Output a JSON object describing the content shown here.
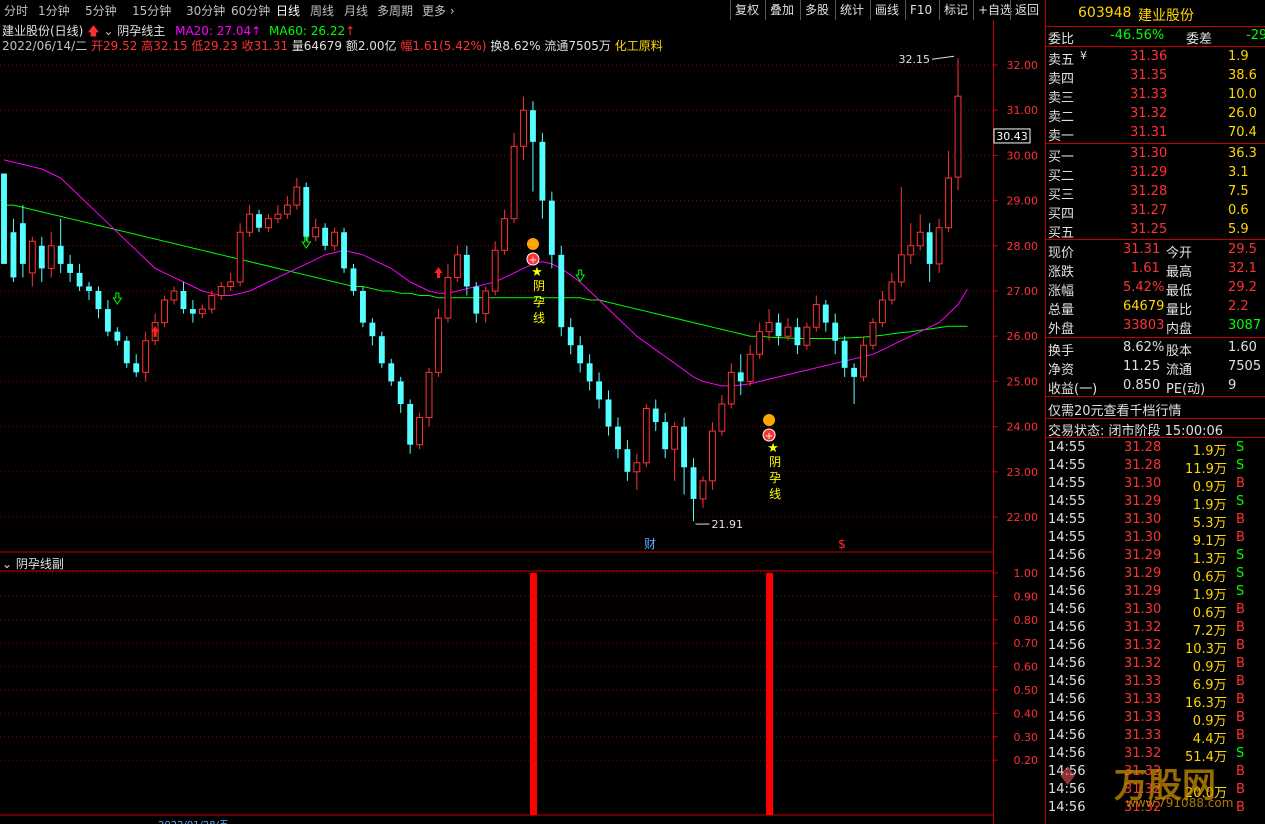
{
  "toolbar": {
    "periods": [
      "分时",
      "1分钟",
      "5分钟",
      "15分钟",
      "30分钟",
      "60分钟",
      "日线",
      "周线",
      "月线",
      "多周期",
      "更多"
    ],
    "active_period": "日线",
    "buttons": [
      "复权",
      "叠加",
      "多股",
      "统计",
      "画线",
      "F10",
      "标记",
      "+自选",
      "返回"
    ]
  },
  "chart_header": {
    "title": "建业股份(日线)",
    "indicator": "阴孕线主",
    "ma20": "MA20: 27.04",
    "ma60": "MA60: 26.22",
    "date": "2022/06/14/二",
    "open": "开29.52",
    "high": "高32.15",
    "low": "低29.23",
    "close": "收31.31",
    "volume": "量64679",
    "amount": "额2.00亿",
    "change": "幅1.61(5.42%)",
    "turnover": "换8.62%",
    "float": "流通7505万",
    "sector": "化工原料"
  },
  "sub_header": "阴孕线副",
  "annotations": {
    "peak": "32.15",
    "trough": "21.91",
    "signal_text": "阴孕线",
    "badge_cai": "财",
    "badge_dollar": "$",
    "current_price": "30.43"
  },
  "colors": {
    "up": "#ff3232",
    "down": "#54ffff",
    "ma20": "#ff00ff",
    "ma60": "#00ff00",
    "grid": "#8b0000",
    "signal": "#ff0000"
  },
  "main_axis": [
    "32.00",
    "31.00",
    "30.00",
    "29.00",
    "28.00",
    "27.00",
    "26.00",
    "25.00",
    "24.00",
    "23.00",
    "22.00"
  ],
  "sub_axis": [
    "1.00",
    "0.90",
    "0.80",
    "0.70",
    "0.60",
    "0.50",
    "0.40",
    "0.30",
    "0.20"
  ],
  "bottom_date": "2022/01/28/五",
  "panel": {
    "code": "603948",
    "name": "建业股份",
    "webi_label": "委比",
    "webi_value": "-46.56%",
    "weicha_label": "委差",
    "weicha_value": "-29",
    "asks": [
      {
        "label": "卖五",
        "price": "31.36",
        "vol": "1.9"
      },
      {
        "label": "卖四",
        "price": "31.35",
        "vol": "38.6"
      },
      {
        "label": "卖三",
        "price": "31.33",
        "vol": "10.0"
      },
      {
        "label": "卖二",
        "price": "31.32",
        "vol": "26.0"
      },
      {
        "label": "卖一",
        "price": "31.31",
        "vol": "70.4"
      }
    ],
    "bids": [
      {
        "label": "买一",
        "price": "31.30",
        "vol": "36.3"
      },
      {
        "label": "买二",
        "price": "31.29",
        "vol": "3.1"
      },
      {
        "label": "买三",
        "price": "31.28",
        "vol": "7.5"
      },
      {
        "label": "买四",
        "price": "31.27",
        "vol": "0.6"
      },
      {
        "label": "买五",
        "price": "31.25",
        "vol": "5.9"
      }
    ],
    "stats": [
      {
        "l1": "现价",
        "v1": "31.31",
        "l2": "今开",
        "v2": "29.5"
      },
      {
        "l1": "涨跌",
        "v1": "1.61",
        "l2": "最高",
        "v2": "32.1"
      },
      {
        "l1": "涨幅",
        "v1": "5.42%",
        "l2": "最低",
        "v2": "29.2"
      },
      {
        "l1": "总量",
        "v1": "64679",
        "l2": "量比",
        "v2": "2.2"
      },
      {
        "l1": "外盘",
        "v1": "33803",
        "l2": "内盘",
        "v2": "3087"
      }
    ],
    "stats2": [
      {
        "l1": "换手",
        "v1": "8.62%",
        "l2": "股本",
        "v2": "1.60"
      },
      {
        "l1": "净资",
        "v1": "11.25",
        "l2": "流通",
        "v2": "7505"
      },
      {
        "l1": "收益(一)",
        "v1": "0.850",
        "l2": "PE(动)",
        "v2": "9"
      }
    ],
    "promo": "仅需20元查看千档行情",
    "status": "交易状态: 闭市阶段 15:00:06",
    "trades": [
      {
        "time": "14:55",
        "price": "31.28",
        "vol": "1.9万",
        "side": "S"
      },
      {
        "time": "14:55",
        "price": "31.28",
        "vol": "11.9万",
        "side": "S"
      },
      {
        "time": "14:55",
        "price": "31.30",
        "vol": "0.9万",
        "side": "B"
      },
      {
        "time": "14:55",
        "price": "31.29",
        "vol": "1.9万",
        "side": "S"
      },
      {
        "time": "14:55",
        "price": "31.30",
        "vol": "5.3万",
        "side": "B"
      },
      {
        "time": "14:55",
        "price": "31.30",
        "vol": "9.1万",
        "side": "B"
      },
      {
        "time": "14:56",
        "price": "31.29",
        "vol": "1.3万",
        "side": "S"
      },
      {
        "time": "14:56",
        "price": "31.29",
        "vol": "0.6万",
        "side": "S"
      },
      {
        "time": "14:56",
        "price": "31.29",
        "vol": "1.9万",
        "side": "S"
      },
      {
        "time": "14:56",
        "price": "31.30",
        "vol": "0.6万",
        "side": "B"
      },
      {
        "time": "14:56",
        "price": "31.32",
        "vol": "7.2万",
        "side": "B"
      },
      {
        "time": "14:56",
        "price": "31.32",
        "vol": "10.3万",
        "side": "B"
      },
      {
        "time": "14:56",
        "price": "31.32",
        "vol": "0.9万",
        "side": "B"
      },
      {
        "time": "14:56",
        "price": "31.33",
        "vol": "6.9万",
        "side": "B"
      },
      {
        "time": "14:56",
        "price": "31.33",
        "vol": "16.3万",
        "side": "B"
      },
      {
        "time": "14:56",
        "price": "31.33",
        "vol": "0.9万",
        "side": "B"
      },
      {
        "time": "14:56",
        "price": "31.33",
        "vol": "4.4万",
        "side": "B"
      },
      {
        "time": "14:56",
        "price": "31.32",
        "vol": "51.4万",
        "side": "S"
      },
      {
        "time": "14:56",
        "price": "31.32",
        "vol": "",
        "side": "B"
      },
      {
        "time": "14:56",
        "price": "31.32",
        "vol": "20.0万",
        "side": "B"
      },
      {
        "time": "14:56",
        "price": "31.32",
        "vol": "",
        "side": "B"
      }
    ],
    "watermark": "万股网",
    "watermark_url": "www.791088.com"
  },
  "chart_data": {
    "type": "candlestick",
    "ylim": [
      21.5,
      32.3
    ],
    "candles": [
      [
        29.6,
        27.6,
        29.6,
        27.6
      ],
      [
        28.3,
        27.3,
        28.6,
        27.2
      ],
      [
        28.5,
        27.6,
        28.9,
        27.3
      ],
      [
        27.4,
        28.1,
        28.2,
        27.1
      ],
      [
        28.0,
        27.5,
        28.2,
        27.2
      ],
      [
        27.5,
        28.0,
        28.3,
        27.3
      ],
      [
        28.0,
        27.6,
        28.6,
        27.4
      ],
      [
        27.6,
        27.4,
        27.8,
        27.2
      ],
      [
        27.4,
        27.1,
        27.6,
        27.0
      ],
      [
        27.1,
        27.0,
        27.2,
        26.8
      ],
      [
        27.0,
        26.6,
        27.1,
        26.4
      ],
      [
        26.6,
        26.1,
        26.8,
        26.0
      ],
      [
        26.1,
        25.9,
        26.2,
        25.8
      ],
      [
        25.9,
        25.4,
        26.0,
        25.3
      ],
      [
        25.4,
        25.2,
        25.6,
        25.1
      ],
      [
        25.2,
        25.9,
        26.1,
        25.0
      ],
      [
        25.9,
        26.3,
        26.5,
        25.8
      ],
      [
        26.3,
        26.8,
        26.9,
        26.2
      ],
      [
        26.8,
        27.0,
        27.1,
        26.7
      ],
      [
        27.0,
        26.6,
        27.2,
        26.5
      ],
      [
        26.6,
        26.5,
        26.8,
        26.3
      ],
      [
        26.5,
        26.6,
        26.7,
        26.4
      ],
      [
        26.6,
        26.9,
        27.0,
        26.5
      ],
      [
        26.9,
        27.1,
        27.2,
        26.8
      ],
      [
        27.1,
        27.2,
        27.4,
        27.0
      ],
      [
        27.2,
        28.3,
        28.5,
        27.1
      ],
      [
        28.3,
        28.7,
        28.9,
        28.2
      ],
      [
        28.7,
        28.4,
        28.8,
        28.3
      ],
      [
        28.4,
        28.6,
        28.7,
        28.3
      ],
      [
        28.6,
        28.7,
        28.9,
        28.5
      ],
      [
        28.7,
        28.9,
        29.1,
        28.6
      ],
      [
        28.9,
        29.3,
        29.5,
        28.8
      ],
      [
        29.3,
        28.2,
        29.4,
        28.1
      ],
      [
        28.2,
        28.4,
        28.6,
        28.1
      ],
      [
        28.4,
        28.0,
        28.5,
        27.9
      ],
      [
        28.0,
        28.3,
        28.4,
        27.9
      ],
      [
        28.3,
        27.5,
        28.4,
        27.4
      ],
      [
        27.5,
        27.0,
        27.6,
        26.9
      ],
      [
        27.0,
        26.3,
        27.1,
        26.2
      ],
      [
        26.3,
        26.0,
        26.4,
        25.8
      ],
      [
        26.0,
        25.4,
        26.1,
        25.3
      ],
      [
        25.4,
        25.0,
        25.5,
        24.9
      ],
      [
        25.0,
        24.5,
        25.1,
        24.3
      ],
      [
        24.5,
        23.6,
        24.6,
        23.4
      ],
      [
        23.6,
        24.2,
        24.3,
        23.5
      ],
      [
        24.2,
        25.2,
        25.3,
        24.0
      ],
      [
        25.2,
        26.4,
        26.6,
        25.1
      ],
      [
        26.4,
        27.3,
        27.6,
        26.3
      ],
      [
        27.3,
        27.8,
        28.0,
        27.2
      ],
      [
        27.8,
        27.1,
        28.0,
        26.9
      ],
      [
        27.1,
        26.5,
        27.2,
        26.3
      ],
      [
        26.5,
        27.0,
        27.1,
        26.3
      ],
      [
        27.0,
        27.9,
        28.1,
        26.9
      ],
      [
        27.9,
        28.6,
        28.8,
        27.8
      ],
      [
        28.6,
        30.2,
        30.5,
        28.5
      ],
      [
        30.2,
        31.0,
        31.3,
        29.9
      ],
      [
        31.0,
        30.3,
        31.2,
        29.2
      ],
      [
        30.3,
        29.0,
        30.5,
        28.6
      ],
      [
        29.0,
        27.8,
        29.2,
        27.5
      ],
      [
        27.8,
        26.2,
        28.0,
        26.0
      ],
      [
        26.2,
        25.8,
        26.4,
        25.6
      ],
      [
        25.8,
        25.4,
        26.0,
        25.2
      ],
      [
        25.4,
        25.0,
        25.6,
        24.8
      ],
      [
        25.0,
        24.6,
        25.2,
        24.4
      ],
      [
        24.6,
        24.0,
        24.8,
        23.8
      ],
      [
        24.0,
        23.5,
        24.2,
        23.3
      ],
      [
        23.5,
        23.0,
        23.7,
        22.8
      ],
      [
        23.0,
        23.2,
        23.4,
        22.6
      ],
      [
        23.2,
        24.4,
        24.5,
        23.1
      ],
      [
        24.4,
        24.1,
        24.6,
        23.9
      ],
      [
        24.1,
        23.5,
        24.3,
        23.3
      ],
      [
        23.5,
        24.0,
        24.1,
        22.8
      ],
      [
        24.0,
        23.1,
        24.2,
        22.5
      ],
      [
        23.1,
        22.4,
        23.3,
        21.91
      ],
      [
        22.4,
        22.8,
        22.9,
        22.2
      ],
      [
        22.8,
        23.9,
        24.1,
        22.6
      ],
      [
        23.9,
        24.5,
        24.7,
        23.8
      ],
      [
        24.5,
        25.2,
        25.4,
        24.4
      ],
      [
        25.2,
        25.0,
        25.6,
        24.7
      ],
      [
        25.0,
        25.6,
        25.8,
        24.9
      ],
      [
        25.6,
        26.1,
        26.3,
        25.5
      ],
      [
        26.1,
        26.3,
        26.6,
        25.9
      ],
      [
        26.3,
        26.0,
        26.5,
        25.8
      ],
      [
        26.0,
        26.2,
        26.4,
        25.9
      ],
      [
        26.2,
        25.8,
        26.4,
        25.6
      ],
      [
        25.8,
        26.2,
        26.3,
        25.7
      ],
      [
        26.2,
        26.7,
        26.9,
        26.1
      ],
      [
        26.7,
        26.3,
        26.8,
        26.1
      ],
      [
        26.3,
        25.9,
        26.5,
        25.6
      ],
      [
        25.9,
        25.3,
        26.0,
        25.1
      ],
      [
        25.3,
        25.1,
        25.4,
        24.5
      ],
      [
        25.1,
        25.8,
        26.0,
        25.0
      ],
      [
        25.8,
        26.3,
        26.4,
        25.7
      ],
      [
        26.3,
        26.8,
        27.0,
        26.2
      ],
      [
        26.8,
        27.2,
        27.4,
        26.7
      ],
      [
        27.2,
        27.8,
        29.3,
        27.1
      ],
      [
        27.8,
        28.0,
        28.5,
        27.6
      ],
      [
        28.0,
        28.3,
        28.7,
        27.9
      ],
      [
        28.3,
        27.6,
        28.5,
        27.2
      ],
      [
        27.6,
        28.4,
        28.6,
        27.4
      ],
      [
        28.4,
        29.5,
        30.1,
        28.3
      ],
      [
        29.52,
        31.31,
        32.15,
        29.23
      ]
    ],
    "ma20": [
      29.9,
      29.85,
      29.8,
      29.75,
      29.7,
      29.6,
      29.5,
      29.3,
      29.1,
      28.9,
      28.7,
      28.5,
      28.3,
      28.1,
      27.9,
      27.7,
      27.5,
      27.4,
      27.3,
      27.2,
      27.1,
      27.0,
      26.95,
      26.9,
      26.9,
      26.95,
      27.0,
      27.1,
      27.2,
      27.3,
      27.4,
      27.5,
      27.6,
      27.7,
      27.8,
      27.85,
      27.9,
      27.85,
      27.8,
      27.7,
      27.6,
      27.5,
      27.35,
      27.2,
      27.1,
      27.0,
      26.95,
      26.95,
      27.0,
      27.05,
      27.1,
      27.15,
      27.2,
      27.3,
      27.4,
      27.5,
      27.6,
      27.65,
      27.6,
      27.5,
      27.35,
      27.2,
      27.0,
      26.8,
      26.6,
      26.4,
      26.2,
      26.0,
      25.85,
      25.7,
      25.55,
      25.4,
      25.25,
      25.1,
      25.0,
      24.95,
      24.9,
      24.9,
      24.92,
      24.95,
      25.0,
      25.05,
      25.1,
      25.15,
      25.2,
      25.25,
      25.3,
      25.35,
      25.4,
      25.45,
      25.5,
      25.55,
      25.6,
      25.7,
      25.8,
      25.9,
      26.0,
      26.1,
      26.2,
      26.3,
      26.5,
      26.7,
      27.04
    ],
    "ma60": [
      28.9,
      28.9,
      28.85,
      28.8,
      28.75,
      28.7,
      28.65,
      28.6,
      28.55,
      28.5,
      28.45,
      28.4,
      28.35,
      28.3,
      28.25,
      28.2,
      28.15,
      28.1,
      28.05,
      28.0,
      27.95,
      27.9,
      27.85,
      27.8,
      27.75,
      27.7,
      27.65,
      27.6,
      27.55,
      27.5,
      27.45,
      27.4,
      27.35,
      27.3,
      27.25,
      27.2,
      27.15,
      27.1,
      27.1,
      27.05,
      27.0,
      27.0,
      26.95,
      26.95,
      26.9,
      26.9,
      26.85,
      26.85,
      26.85,
      26.85,
      26.85,
      26.85,
      26.85,
      26.85,
      26.85,
      26.85,
      26.85,
      26.85,
      26.85,
      26.85,
      26.85,
      26.85,
      26.8,
      26.8,
      26.75,
      26.7,
      26.65,
      26.6,
      26.55,
      26.5,
      26.45,
      26.4,
      26.35,
      26.3,
      26.25,
      26.2,
      26.15,
      26.1,
      26.05,
      26.0,
      26.0,
      25.98,
      25.97,
      25.96,
      25.95,
      25.95,
      25.95,
      25.95,
      25.95,
      25.96,
      25.97,
      25.98,
      26.0,
      26.02,
      26.05,
      26.08,
      26.1,
      26.13,
      26.16,
      26.19,
      26.22,
      26.22,
      26.22
    ],
    "signal_bars": [
      {
        "x_index": 56,
        "value": 1.0
      },
      {
        "x_index": 81,
        "value": 1.0
      }
    ],
    "sub_ylim": [
      0,
      1.0
    ]
  }
}
